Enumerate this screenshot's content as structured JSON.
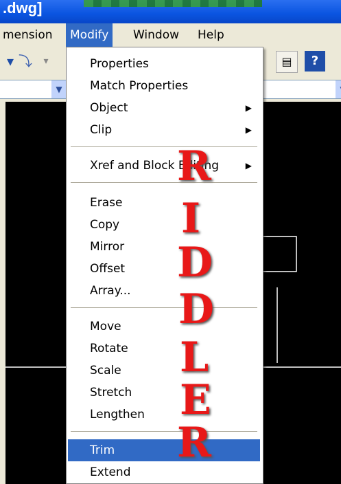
{
  "window": {
    "title": ".dwg]"
  },
  "menubar": {
    "items": [
      "mension",
      "Modify",
      "Window",
      "Help"
    ]
  },
  "dropdown": {
    "groups": [
      [
        "Properties",
        "Match Properties",
        "Object",
        "Clip"
      ],
      [
        "Xref and Block Editing"
      ],
      [
        "Erase",
        "Copy",
        "Mirror",
        "Offset",
        "Array..."
      ],
      [
        "Move",
        "Rotate",
        "Scale",
        "Stretch",
        "Lengthen"
      ],
      [
        "Trim",
        "Extend"
      ]
    ],
    "submenu_items": [
      "Object",
      "Clip",
      "Xref and Block Editing"
    ],
    "highlighted": "Trim"
  },
  "overlay": {
    "letters": [
      "R",
      "I",
      "D",
      "D",
      "L",
      "E",
      "R"
    ],
    "color": "#e81818"
  },
  "colors": {
    "highlight": "#316ac5",
    "title_bar": "#0a54e0"
  }
}
